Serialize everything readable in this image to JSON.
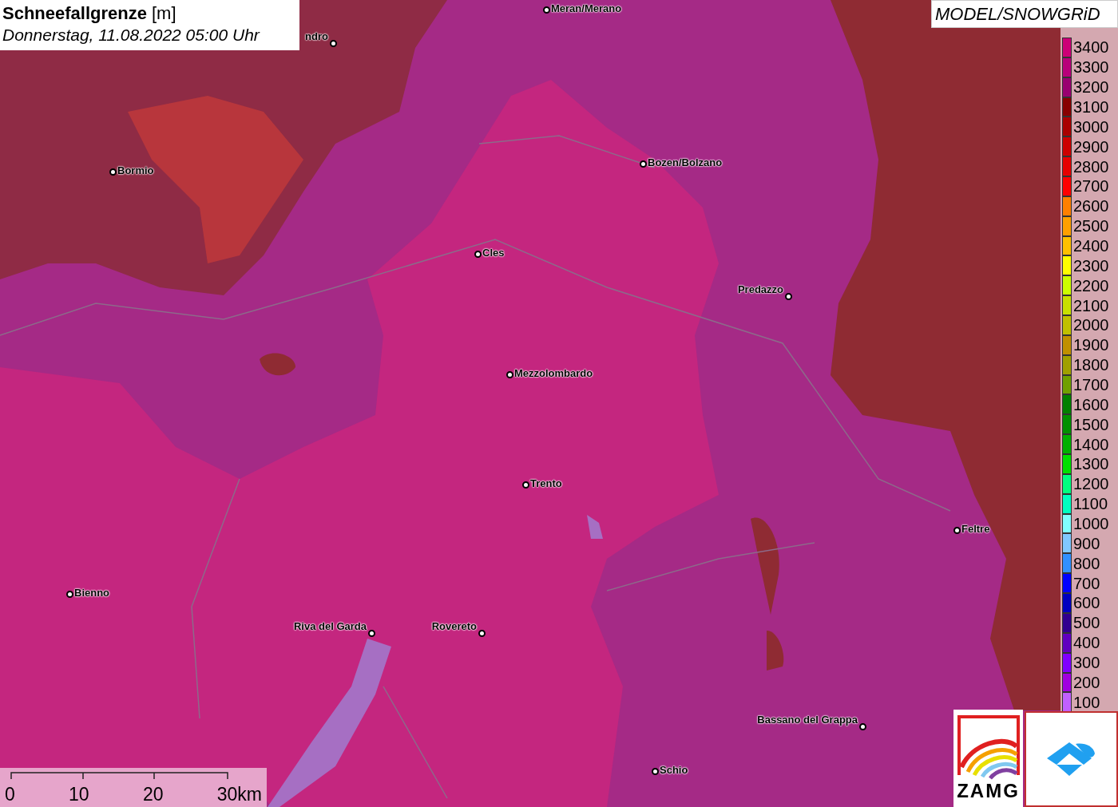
{
  "title": {
    "name": "Schneefallgrenze",
    "unit": "[m]",
    "date": "Donnerstag, 11.08.2022 05:00 Uhr"
  },
  "source": "MODEL/SNOWGRiD",
  "places": [
    {
      "name": "Meran/Merano"
    },
    {
      "name": "ndro"
    },
    {
      "name": "Bormio"
    },
    {
      "name": "Bozen/Bolzano"
    },
    {
      "name": "Cles"
    },
    {
      "name": "Predazzo"
    },
    {
      "name": "Mezzolombardo"
    },
    {
      "name": "Trento"
    },
    {
      "name": "Feltre"
    },
    {
      "name": "Bienno"
    },
    {
      "name": "Riva del Garda"
    },
    {
      "name": "Rovereto"
    },
    {
      "name": "Bassano del Grappa"
    },
    {
      "name": "Schio"
    }
  ],
  "legend": [
    {
      "label": "3400",
      "color": "#cc0077"
    },
    {
      "label": "3300",
      "color": "#b8007a"
    },
    {
      "label": "3200",
      "color": "#990070"
    },
    {
      "label": "3100",
      "color": "#880000"
    },
    {
      "label": "3000",
      "color": "#aa0000"
    },
    {
      "label": "2900",
      "color": "#cc0000"
    },
    {
      "label": "2800",
      "color": "#e60000"
    },
    {
      "label": "2700",
      "color": "#ff0000"
    },
    {
      "label": "2600",
      "color": "#ff8000"
    },
    {
      "label": "2500",
      "color": "#ffa000"
    },
    {
      "label": "2400",
      "color": "#ffc000"
    },
    {
      "label": "2300",
      "color": "#ffff00"
    },
    {
      "label": "2200",
      "color": "#ccff00"
    },
    {
      "label": "2100",
      "color": "#c8e000"
    },
    {
      "label": "2000",
      "color": "#c0c000"
    },
    {
      "label": "1900",
      "color": "#c09000"
    },
    {
      "label": "1800",
      "color": "#a0a000"
    },
    {
      "label": "1700",
      "color": "#70a000"
    },
    {
      "label": "1600",
      "color": "#008000"
    },
    {
      "label": "1500",
      "color": "#009000"
    },
    {
      "label": "1400",
      "color": "#00b000"
    },
    {
      "label": "1300",
      "color": "#00e000"
    },
    {
      "label": "1200",
      "color": "#00ff80"
    },
    {
      "label": "1100",
      "color": "#00ffc0"
    },
    {
      "label": "1000",
      "color": "#80ffff"
    },
    {
      "label": "900",
      "color": "#80c8ff"
    },
    {
      "label": "800",
      "color": "#3090ff"
    },
    {
      "label": "700",
      "color": "#0000ff"
    },
    {
      "label": "600",
      "color": "#0000c0"
    },
    {
      "label": "500",
      "color": "#300090"
    },
    {
      "label": "400",
      "color": "#6000c0"
    },
    {
      "label": "300",
      "color": "#8000ff"
    },
    {
      "label": "200",
      "color": "#a000e0"
    },
    {
      "label": "100",
      "color": "#c060ff"
    }
  ],
  "scale_bar": [
    "0",
    "10",
    "20",
    "30km"
  ],
  "logo_text": "ZAMG"
}
